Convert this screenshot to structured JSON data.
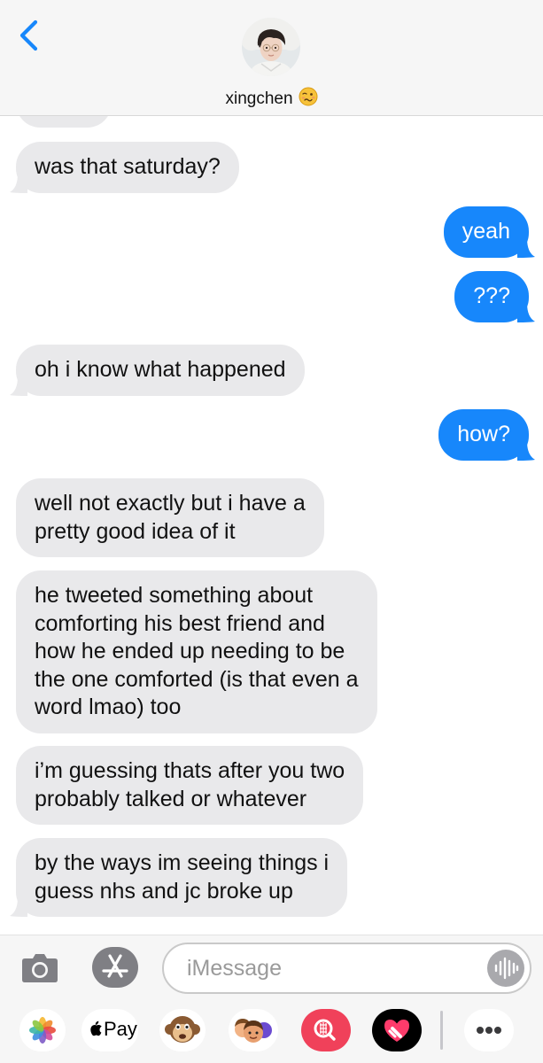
{
  "header": {
    "contact_name": "xingchen",
    "name_emoji": "🥴",
    "back_icon": "chevron-left-icon"
  },
  "messages": [
    {
      "from": "them",
      "text": "was that saturday?"
    },
    {
      "from": "me",
      "text": "yeah"
    },
    {
      "from": "me",
      "text": "???"
    },
    {
      "from": "them",
      "text": "oh i know what happened"
    },
    {
      "from": "me",
      "text": "how?"
    },
    {
      "from": "them",
      "lines": [
        "well not exactly but i have a",
        "pretty good idea of it"
      ]
    },
    {
      "from": "them",
      "lines": [
        "he tweeted something about",
        "comforting his best friend and",
        "how he ended up needing to be",
        "the one comforted (is that even a",
        "word lmao) too"
      ]
    },
    {
      "from": "them",
      "lines": [
        "i’m guessing thats after you two",
        "probably talked or whatever"
      ]
    },
    {
      "from": "them",
      "lines": [
        "by the ways im seeing things i",
        "guess nhs and jc broke up"
      ]
    }
  ],
  "composer": {
    "placeholder": "iMessage",
    "icons": [
      "camera-icon",
      "app-store-icon",
      "audio-waveform-icon"
    ]
  },
  "app_drawer": {
    "apple_pay_label": "Pay",
    "apps": [
      "photos-icon",
      "apple-pay-icon",
      "monkey-animoji-icon",
      "memoji-icon",
      "image-search-icon",
      "heart-sticker-icon",
      "more-icon"
    ]
  },
  "colors": {
    "sent_bubble": "#1787fb",
    "received_bubble": "#e9e9eb",
    "accent": "#1787fb"
  }
}
